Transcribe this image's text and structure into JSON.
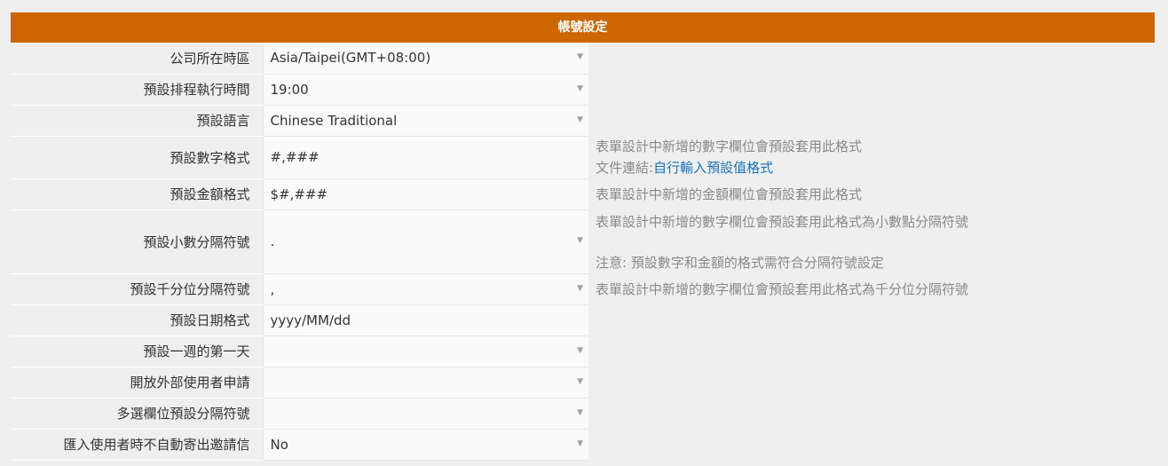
{
  "header": {
    "title": "帳號設定"
  },
  "rows": [
    {
      "label": "公司所在時區",
      "value": "Asia/Taipei(GMT+08:00)"
    },
    {
      "label": "預設排程執行時間",
      "value": "19:00"
    },
    {
      "label": "預設語言",
      "value": "Chinese Traditional"
    },
    {
      "label": "預設數字格式",
      "value": "#,###"
    },
    {
      "label": "預設金額格式",
      "value": "$#,###"
    },
    {
      "label": "預設小數分隔符號",
      "value": "."
    },
    {
      "label": "預設千分位分隔符號",
      "value": ","
    },
    {
      "label": "預設日期格式",
      "value": "yyyy/MM/dd"
    },
    {
      "label": "預設一週的第一天",
      "value": ""
    },
    {
      "label": "開放外部使用者申請",
      "value": ""
    },
    {
      "label": "多選欄位預設分隔符號",
      "value": ""
    },
    {
      "label": "匯入使用者時不自動寄出邀請信",
      "value": "No"
    }
  ],
  "notes": {
    "number_format": "表單設計中新增的數字欄位會預設套用此格式",
    "doc_prefix": "文件連結:",
    "doc_link": "自行輸入預設值格式",
    "currency_format": "表單設計中新增的金額欄位會預設套用此格式",
    "decimal_sep": "表單設計中新增的數字欄位會預設套用此格式為小數點分隔符號",
    "decimal_warning": "注意: 預設數字和金額的格式需符合分隔符號設定",
    "thousand_sep": "表單設計中新增的數字欄位會預設套用此格式為千分位分隔符號"
  },
  "icons": {
    "dropdown": "caret-down-icon"
  },
  "colors": {
    "header_bg": "#cc6600",
    "link": "#1a73b8",
    "note_text": "#8a8a8a"
  }
}
